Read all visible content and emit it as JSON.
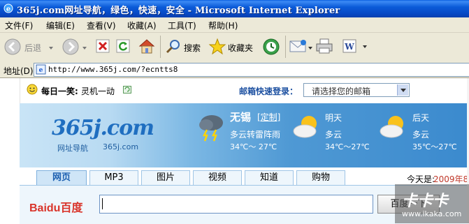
{
  "window": {
    "title": "365j.com网址导航，绿色，快速，安全 - Microsoft Internet Explorer"
  },
  "menu": {
    "items": [
      "文件(F)",
      "编辑(E)",
      "查看(V)",
      "收藏(A)",
      "工具(T)",
      "帮助(H)"
    ]
  },
  "toolbar": {
    "back_label": "后退",
    "search_label": "搜索",
    "favorites_label": "收藏夹"
  },
  "address": {
    "label": "地址(D)",
    "url": "http://www.365j.com/?ecntts8"
  },
  "page": {
    "daily_joke": {
      "prefix": "每日一笑:",
      "text": "灵机一动"
    },
    "mail_login": {
      "label": "邮箱快速登录：",
      "select_value": "请选择您的邮箱"
    },
    "logo": {
      "main": "365j.com",
      "sub_left": "网址导航",
      "sub_right": "365j.com"
    },
    "weather": {
      "city": "无锡",
      "customize": "[定制]",
      "today": {
        "desc": "多云转雷阵雨",
        "temp": "34℃～ 27℃"
      },
      "tomorrow": {
        "label": "明天",
        "desc": "多云",
        "temp": "34℃～27℃"
      },
      "after": {
        "label": "后天",
        "desc": "多云",
        "temp": "35℃～27℃"
      }
    },
    "tabs": [
      "网页",
      "MP3",
      "图片",
      "视频",
      "知道",
      "购物"
    ],
    "active_tab": "网页",
    "date": {
      "prefix": "今天是:",
      "value": "2009年8,"
    },
    "search": {
      "engine_logo": "Baidu百度",
      "button_label": "百度一下",
      "input_value": ""
    },
    "watermark": {
      "text": "卡卡卡",
      "url": "www.ikaka.com"
    },
    "colors": {
      "titlebar": "#0b5bd8",
      "chrome": "#ece9d8",
      "banner_light": "#c9e4f6",
      "banner_dark": "#3b8ace",
      "link_blue": "#1b4fa0",
      "baidu_red": "#d9352b",
      "baidu_blue": "#2b5fd9"
    }
  }
}
